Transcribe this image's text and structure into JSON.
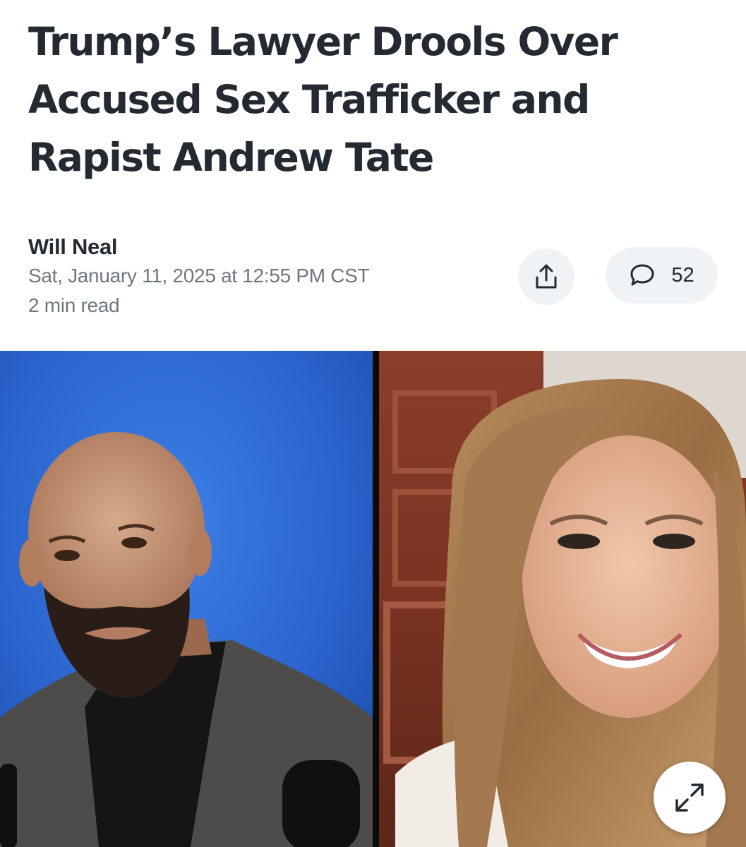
{
  "article": {
    "headline": "Trump’s Lawyer Drools Over Accused Sex Trafficker and Rapist Andrew Tate",
    "author": "Will Neal",
    "date": "Sat, January 11, 2025 at 12:55 PM CST",
    "read_time": "2 min read"
  },
  "actions": {
    "share_icon": "share-icon",
    "comment_icon": "comment-bubble-icon",
    "comment_count": "52",
    "expand_icon": "expand-arrows-icon"
  },
  "media": {
    "description_left": "man-video-feed",
    "description_right": "woman-video-feed"
  },
  "colors": {
    "headline": "#232a31",
    "meta_text": "#6e7780",
    "button_bg": "#f0f3f5",
    "left_backdrop": "#2d66cf"
  }
}
